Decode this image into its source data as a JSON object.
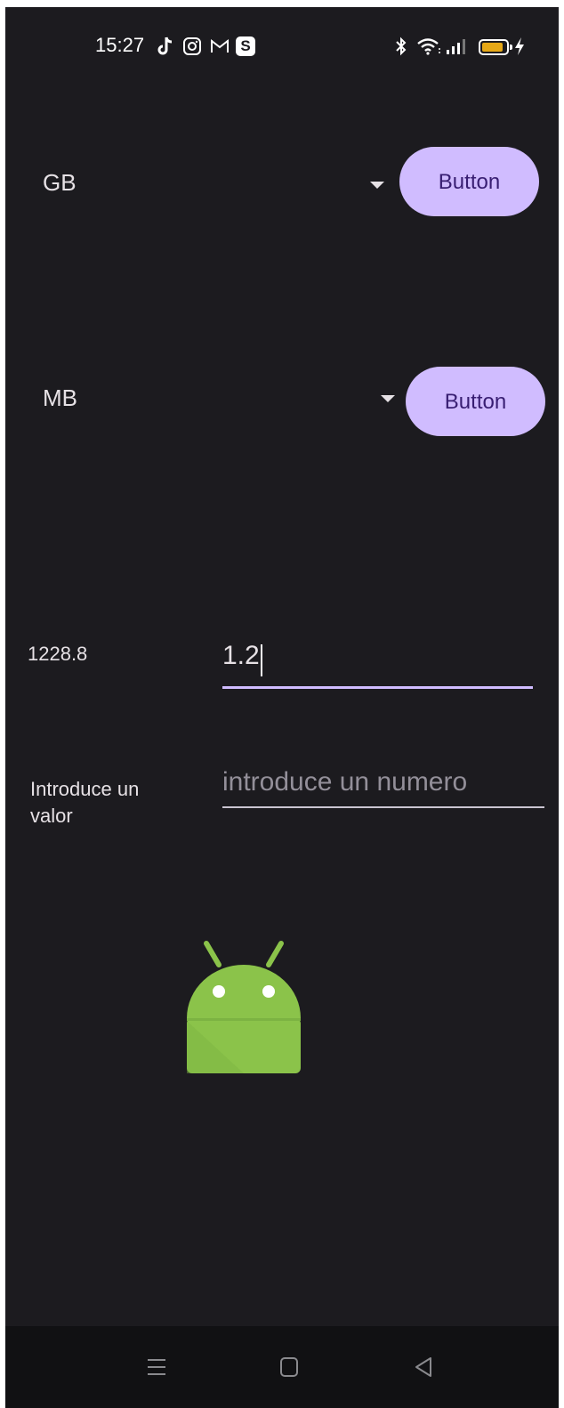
{
  "status_bar": {
    "time": "15:27",
    "notification_icons": [
      "tiktok-icon",
      "instagram-icon",
      "gmail-icon",
      "s-app-icon"
    ],
    "s_app_letter": "S",
    "system_icons": [
      "bluetooth-icon",
      "wifi-icon",
      "signal-icon",
      "battery-icon",
      "charging-icon"
    ],
    "battery_level": 0.9
  },
  "row1": {
    "spinner_value": "GB",
    "button_label": "Button"
  },
  "row2": {
    "spinner_value": "MB",
    "button_label": "Button"
  },
  "result": {
    "value": "1228.8"
  },
  "input1": {
    "value": "1.2"
  },
  "prompt": {
    "label": "Introduce un valor",
    "placeholder": "introduce un numero"
  },
  "image": {
    "icon": "android-robot-icon"
  },
  "nav_bar": {
    "buttons": [
      "menu-icon",
      "home-icon",
      "back-icon"
    ]
  },
  "colors": {
    "background": "#1c1b1f",
    "button": "#d0bcff",
    "button_text": "#381e72",
    "text": "#e6e1e5",
    "android_green": "#8bc34a",
    "battery": "#e6a817"
  }
}
